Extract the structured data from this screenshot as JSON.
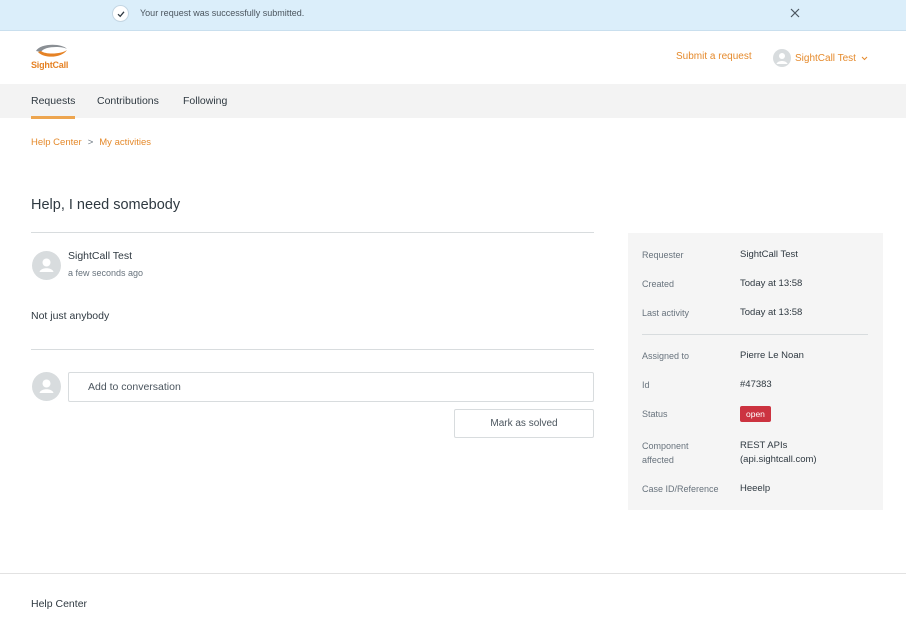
{
  "notice": {
    "message": "Your request was successfully submitted.",
    "icon": "check-icon",
    "close_icon": "close-icon"
  },
  "header": {
    "logo_text": "SightCall",
    "submit_link": "Submit a request",
    "user_name": "SightCall Test",
    "accent_color": "#e58a2c"
  },
  "nav": {
    "tabs": [
      {
        "label": "Requests",
        "active": true
      },
      {
        "label": "Contributions",
        "active": false
      },
      {
        "label": "Following",
        "active": false
      }
    ]
  },
  "breadcrumb": {
    "items": [
      "Help Center",
      "My activities"
    ],
    "separator": ">"
  },
  "request": {
    "title": "Help, I need somebody",
    "author": "SightCall Test",
    "time_ago": "a few seconds ago",
    "body": "Not just anybody",
    "comment_placeholder": "Add to conversation",
    "solve_button": "Mark as solved"
  },
  "details": {
    "requester": {
      "label": "Requester",
      "value": "SightCall Test"
    },
    "created": {
      "label": "Created",
      "value": "Today at 13:58"
    },
    "last_activity": {
      "label": "Last activity",
      "value": "Today at 13:58"
    },
    "assigned_to": {
      "label": "Assigned to",
      "value": "Pierre Le Noan"
    },
    "id": {
      "label": "Id",
      "value": "#47383"
    },
    "status": {
      "label": "Status",
      "value": "open",
      "color": "#cc3340"
    },
    "component": {
      "label_line1": "Component",
      "label_line2": "affected",
      "value_line1": "REST APIs",
      "value_line2": "(api.sightcall.com)"
    },
    "case_ref": {
      "label": "Case ID/Reference",
      "value": "Heeelp"
    }
  },
  "footer": {
    "text": "Help Center"
  }
}
